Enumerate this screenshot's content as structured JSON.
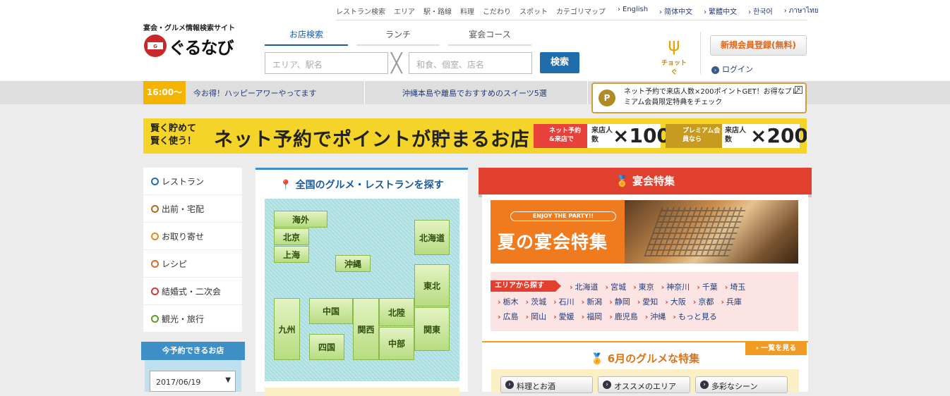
{
  "header": {
    "top_nav": [
      "レストラン検索",
      "エリア",
      "駅・路線",
      "料理",
      "こだわり",
      "スポット",
      "カテゴリマップ"
    ],
    "languages": [
      "English",
      "简体中文",
      "繁體中文",
      "한국어",
      "ภาษาไทย"
    ],
    "logo_subtitle": "宴会・グルメ情報検索サイト",
    "logo_text": "ぐるなび",
    "tabs": [
      "お店検索",
      "ランチ",
      "宴会コース"
    ],
    "area_placeholder": "エリア、駅名",
    "keyword_placeholder": "和食、個室、店名",
    "search_button": "検索",
    "chotto_label": "チョットぐ",
    "register_button": "新規会員登録(無料)",
    "login_link": "ログイン"
  },
  "info_bar": {
    "time_badge": "16:00〜",
    "happy_hour": "今お得！ハッピーアワーやってます",
    "sweets": "沖縄本島や離島でおすすめのスイーツ5選",
    "popup_badge": "P",
    "popup_text": "ネット予約で来店人数×200ポイントGET！お得なプレミアム会員限定特典をチェック",
    "popup_close": "×"
  },
  "banner": {
    "left": "賢く貯めて 賢く使う！",
    "main": "ネット予約でポイントが貯まるお店",
    "box1_label": "ネット予約&来店で",
    "box1_count_label": "来店人数",
    "box1_value": "×100",
    "box2_label": "プレミアム会員なら",
    "box2_count_label": "来店人数",
    "box2_value": "×200",
    "accent": "#f4d428"
  },
  "sidebar": {
    "items": [
      {
        "label": "レストラン",
        "color": "#1f6dad"
      },
      {
        "label": "出前・宅配",
        "color": "#b46a1e"
      },
      {
        "label": "お取り寄せ",
        "color": "#e08a1a"
      },
      {
        "label": "レシピ",
        "color": "#d86d2e"
      },
      {
        "label": "結婚式・二次会",
        "color": "#d8343a"
      },
      {
        "label": "観光・旅行",
        "color": "#5a9a2e"
      }
    ],
    "today_title": "今予約できるお店",
    "date_value": "2017/06/19"
  },
  "map": {
    "title": "全国のグルメ・レストランを探す",
    "regions": [
      "海外",
      "北京",
      "上海",
      "沖縄",
      "北海道",
      "東北",
      "九州",
      "中国",
      "四国",
      "関西",
      "北陸",
      "中部",
      "関東"
    ]
  },
  "enkai": {
    "title": "宴会特集",
    "promo_small": "ENJOY THE PARTY!!",
    "promo_title": "夏の宴会特集",
    "area_tag": "エリアから探す",
    "areas_row1": [
      "北海道",
      "宮城",
      "東京",
      "神奈川",
      "千葉",
      "埼玉"
    ],
    "areas_row2": [
      "栃木",
      "茨城",
      "石川",
      "新潟",
      "静岡",
      "愛知",
      "大阪",
      "京都",
      "兵庫"
    ],
    "areas_row3": [
      "広島",
      "岡山",
      "愛媛",
      "福岡",
      "鹿児島",
      "沖縄",
      "もっと見る"
    ]
  },
  "gurume": {
    "title": "6月のグルメな特集",
    "more": "一覧を見る",
    "buttons": [
      "料理とお酒",
      "オススメのエリア",
      "多彩なシーン"
    ]
  }
}
